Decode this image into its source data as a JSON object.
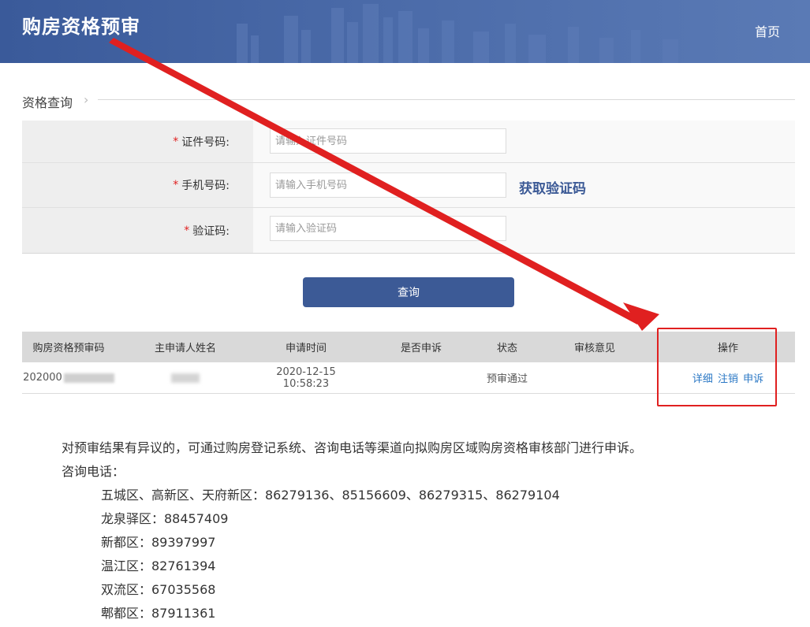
{
  "header": {
    "title": "购房资格预审",
    "home_link": "首页"
  },
  "section": {
    "title": "资格查询"
  },
  "form": {
    "id_label": "证件号码:",
    "id_placeholder": "请输入证件号码",
    "phone_label": "手机号码:",
    "phone_placeholder": "请输入手机号码",
    "get_code_label": "获取验证码",
    "code_label": "验证码:",
    "code_placeholder": "请输入验证码",
    "required_mark": "*"
  },
  "query_button": "查询",
  "table": {
    "headers": [
      "购房资格预审码",
      "主申请人姓名",
      "申请时间",
      "是否申诉",
      "状态",
      "审核意见",
      "操作"
    ],
    "rows": [
      {
        "code_prefix": "202000",
        "time": "2020-12-15 10:58:23",
        "appeal": "",
        "status": "预审通过",
        "opinion": "",
        "actions": [
          "详细",
          "注销",
          "申诉"
        ]
      }
    ]
  },
  "notice": {
    "intro": "对预审结果有异议的，可通过购房登记系统、咨询电话等渠道向拟购房区域购房资格审核部门进行申诉。",
    "phone_title": "咨询电话：",
    "lines": [
      "五城区、高新区、天府新区：86279136、85156609、86279315、86279104",
      "龙泉驿区：88457409",
      "新都区：89397997",
      "温江区：82761394",
      "双流区：67035568",
      "郫都区：87911361"
    ]
  },
  "colors": {
    "header_bg": "#4a6aa8",
    "accent": "#3c5a96",
    "link": "#2b78c5",
    "annotation_red": "#e02020",
    "required_star": "#e02020"
  }
}
